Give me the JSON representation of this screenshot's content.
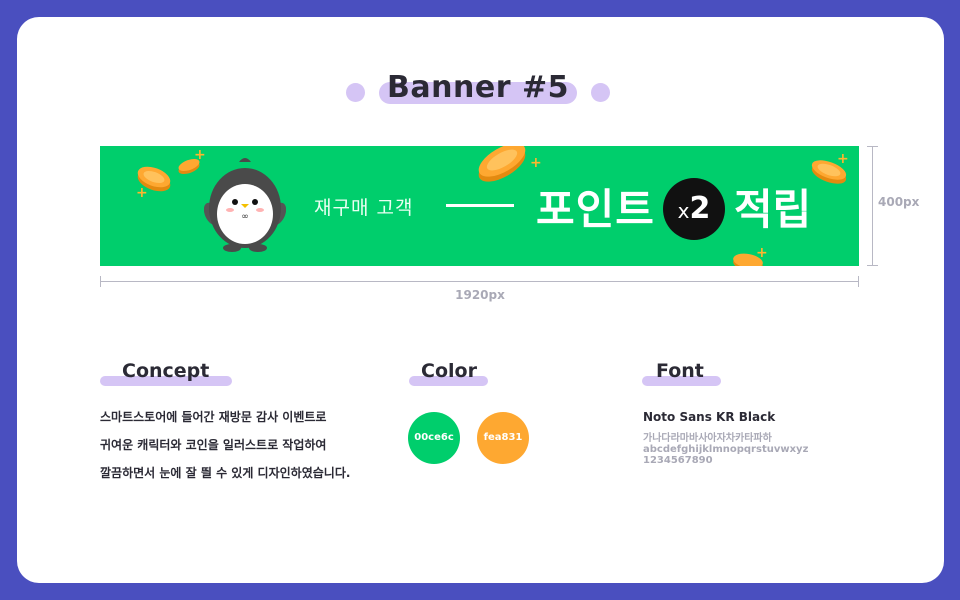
{
  "title": "Banner #5",
  "banner": {
    "subtitle": "재구매 고객",
    "headline": "포인트",
    "badge_x": "x",
    "badge_num": "2",
    "headline_end": "적립",
    "bg_color": "#00ce6c",
    "coin_color": "#fea831"
  },
  "dimensions": {
    "width_label": "1920px",
    "height_label": "400px"
  },
  "concept": {
    "heading": "Concept",
    "lines": [
      "스마트스토어에 들어간 재방문 감사 이벤트로",
      "귀여운 캐릭터와 코인을 일러스트로 작업하여",
      "깔끔하면서 눈에 잘 띌 수 있게 디자인하였습니다."
    ]
  },
  "color": {
    "heading": "Color",
    "swatches": [
      {
        "label": "00ce6c",
        "hex": "#00ce6c"
      },
      {
        "label": "fea831",
        "hex": "#fea831"
      }
    ]
  },
  "font": {
    "heading": "Font",
    "name": "Noto Sans KR Black",
    "sample_lines": [
      "가나다라마바사아자차카타파하",
      "abcdefghijklmnopqrstuvwxyz",
      "1234567890"
    ]
  }
}
